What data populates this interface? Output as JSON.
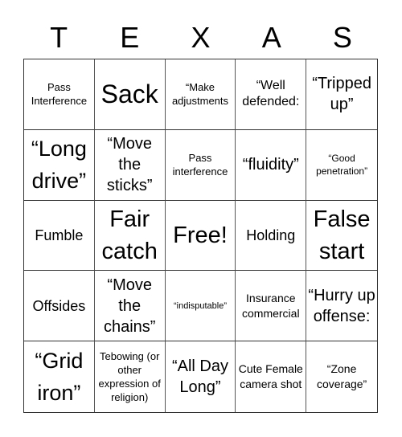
{
  "header": [
    "T",
    "E",
    "X",
    "A",
    "S"
  ],
  "cells": [
    {
      "text": "Pass Interference",
      "size": "s13"
    },
    {
      "text": "Sack",
      "size": "s32"
    },
    {
      "text": "“Make adjustments",
      "size": "s13"
    },
    {
      "text": "“Well defended:",
      "size": "s16"
    },
    {
      "text": "“Tripped up”",
      "size": "s20"
    },
    {
      "text": "“Long drive”",
      "size": "s26"
    },
    {
      "text": "“Move the sticks”",
      "size": "s20"
    },
    {
      "text": "Pass interference",
      "size": "s13"
    },
    {
      "text": "“fluidity”",
      "size": "s20"
    },
    {
      "text": "“Good penetration”",
      "size": "s12"
    },
    {
      "text": "Fumble",
      "size": "s18"
    },
    {
      "text": "Fair catch",
      "size": "s29"
    },
    {
      "text": "Free!",
      "size": "s29"
    },
    {
      "text": "Holding",
      "size": "s18"
    },
    {
      "text": "False start",
      "size": "s29"
    },
    {
      "text": "Offsides",
      "size": "s18"
    },
    {
      "text": "“Move the chains”",
      "size": "s20"
    },
    {
      "text": "“indisputable”",
      "size": "s11"
    },
    {
      "text": "Insurance commercial",
      "size": "s14"
    },
    {
      "text": "“Hurry up offense:",
      "size": "s20"
    },
    {
      "text": "“Grid iron”",
      "size": "s26"
    },
    {
      "text": "Tebowing (or other expression of religion)",
      "size": "s13"
    },
    {
      "text": "“All Day Long”",
      "size": "s20"
    },
    {
      "text": "Cute Female camera shot",
      "size": "s14"
    },
    {
      "text": "“Zone coverage”",
      "size": "s14"
    }
  ]
}
